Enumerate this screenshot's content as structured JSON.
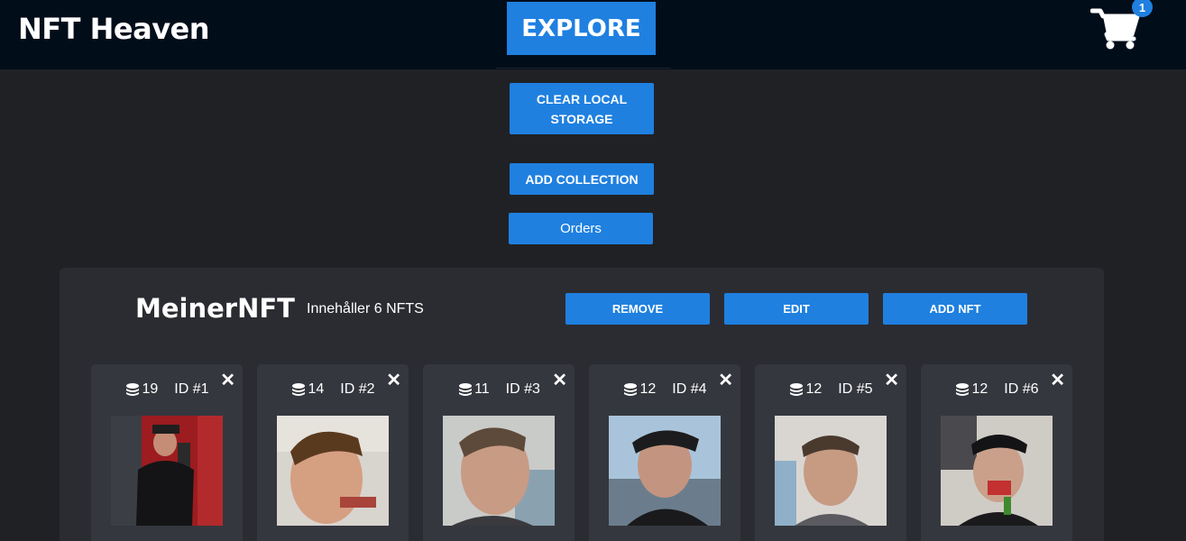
{
  "header": {
    "brand": "NFT Heaven",
    "explore_label": "EXPLORE",
    "cart_count": "1"
  },
  "actions": {
    "clear_storage_label": "CLEAR LOCAL STORAGE",
    "add_collection_label": "ADD COLLECTION",
    "orders_label": "Orders"
  },
  "collection": {
    "title": "MeinerNFT",
    "subtitle": "Innehåller 6 NFTS",
    "remove_label": "REMOVE",
    "edit_label": "EDIT",
    "add_nft_label": "ADD NFT"
  },
  "nfts": [
    {
      "price": "19",
      "id": "ID #1"
    },
    {
      "price": "14",
      "id": "ID #2"
    },
    {
      "price": "11",
      "id": "ID #3"
    },
    {
      "price": "12",
      "id": "ID #4"
    },
    {
      "price": "12",
      "id": "ID #5"
    },
    {
      "price": "12",
      "id": "ID #6"
    }
  ],
  "icons": {
    "cart": "shopping-cart-icon",
    "coins": "coins-icon",
    "close": "close-icon",
    "close_glyph": "✕"
  },
  "colors": {
    "accent": "#1f80e0",
    "background": "#202125",
    "topbar": "#020d1a",
    "panel": "#2b2c31",
    "card": "#35373e"
  }
}
